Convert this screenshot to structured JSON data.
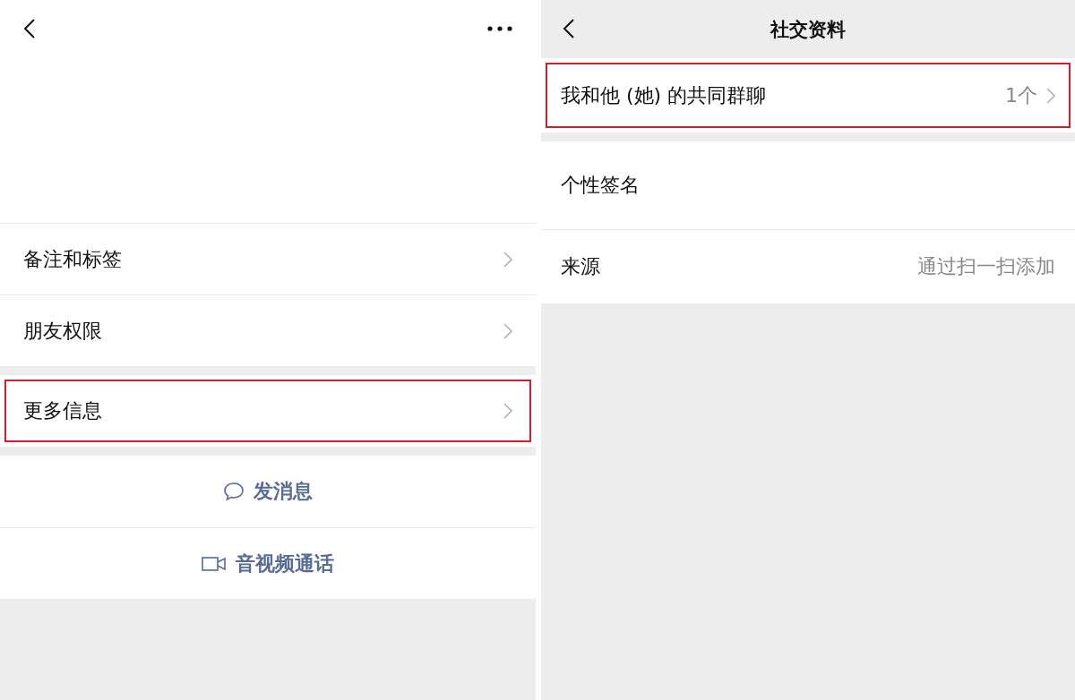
{
  "left_screen": {
    "groups": [
      {
        "items": [
          {
            "kind": "nav",
            "label": "备注和标签",
            "highlighted": false
          },
          {
            "kind": "nav",
            "label": "朋友权限",
            "highlighted": false
          }
        ]
      },
      {
        "items": [
          {
            "kind": "nav",
            "label": "更多信息",
            "highlighted": true
          }
        ]
      },
      {
        "items": [
          {
            "kind": "message",
            "label": "发消息",
            "highlighted": false
          },
          {
            "kind": "video",
            "label": "音视频通话",
            "highlighted": false
          }
        ]
      }
    ]
  },
  "right_screen": {
    "title": "社交资料",
    "groups": [
      {
        "items": [
          {
            "kind": "nav",
            "label": "我和他 (她) 的共同群聊",
            "value": "1个",
            "highlighted": true
          }
        ]
      },
      {
        "items": [
          {
            "kind": "tall",
            "label": "个性签名",
            "highlighted": false
          },
          {
            "kind": "plain",
            "label": "来源",
            "value": "通过扫一扫添加",
            "highlighted": false
          }
        ]
      }
    ]
  }
}
